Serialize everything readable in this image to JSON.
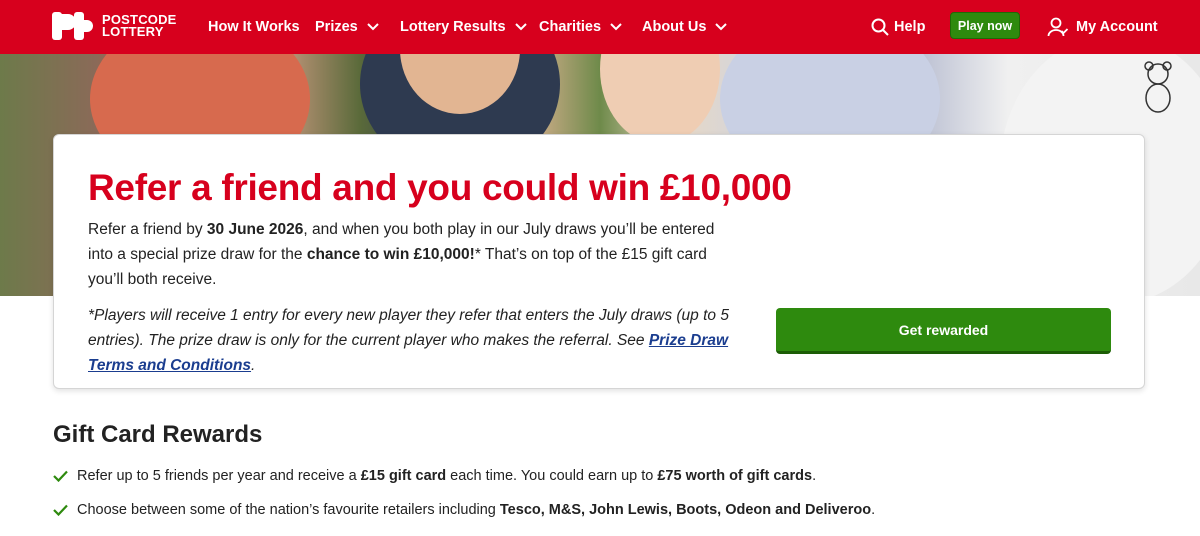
{
  "brand": {
    "line1": "POSTCODE",
    "line2": "LOTTERY"
  },
  "nav": {
    "items": [
      {
        "label": "How It Works"
      },
      {
        "label": "Prizes"
      },
      {
        "label": "Lottery Results"
      },
      {
        "label": "Charities"
      },
      {
        "label": "About Us"
      }
    ],
    "help_label": "Help",
    "play_label": "Play now",
    "account_label": "My Account"
  },
  "colors": {
    "brand_red": "#d7001d",
    "cta_green": "#2e8a0e",
    "link_blue": "#1a3d8f"
  },
  "promo": {
    "title": "Refer a friend and you could win £10,000",
    "intro_a": "Refer a friend by ",
    "intro_date": "30 June 2026",
    "intro_b": ", and when you both play in our July draws you’ll be entered into a special prize draw for the ",
    "intro_bold": "chance to win £10,000!",
    "intro_c": "* That’s on top of the £15 gift card you’ll both receive.",
    "note_a": "*Players will receive 1 entry for every new player they refer that enters the July draws (up to 5 entries). The prize draw is only for the current player who makes the referral. See ",
    "note_link": "Prize Draw Terms and Conditions",
    "note_b": ".",
    "button": "Get rewarded"
  },
  "gift": {
    "title": "Gift Card Rewards",
    "item1_a": "Refer up to 5 friends per year and receive a ",
    "item1_b": "£15 gift card",
    "item1_c": " each time. You could earn up to ",
    "item1_d": "£75 worth of gift cards",
    "item1_e": ".",
    "item2_a": "Choose between some of the nation’s favourite retailers including ",
    "item2_b": "Tesco, M&S, John Lewis, Boots, Odeon and Deliveroo",
    "item2_c": "."
  }
}
